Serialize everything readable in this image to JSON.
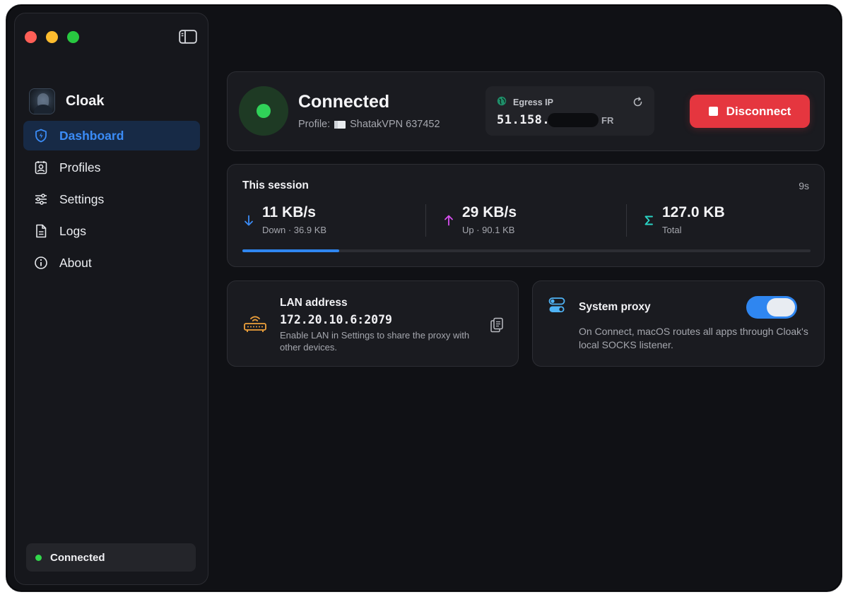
{
  "app": {
    "name": "Cloak"
  },
  "sidebar": {
    "items": [
      {
        "label": "Dashboard",
        "icon": "shield-bolt-icon",
        "active": true
      },
      {
        "label": "Profiles",
        "icon": "contact-card-icon",
        "active": false
      },
      {
        "label": "Settings",
        "icon": "sliders-icon",
        "active": false
      },
      {
        "label": "Logs",
        "icon": "document-icon",
        "active": false
      },
      {
        "label": "About",
        "icon": "info-icon",
        "active": false
      }
    ],
    "status_label": "Connected"
  },
  "status": {
    "title": "Connected",
    "profile_prefix": "Profile:",
    "profile_name": "ShatakVPN 637452",
    "egress": {
      "label": "Egress IP",
      "ip_visible": "51.158.",
      "country": "FR"
    },
    "disconnect_label": "Disconnect"
  },
  "session": {
    "title": "This session",
    "elapsed": "9s",
    "down": {
      "value": "11 KB/s",
      "sub": "Down · 36.9 KB"
    },
    "up": {
      "value": "29 KB/s",
      "sub": "Up · 90.1 KB"
    },
    "total": {
      "value": "127.0 KB",
      "sub": "Total"
    },
    "progress_fraction": 0.17
  },
  "lan": {
    "title": "LAN address",
    "address": "172.20.10.6:2079",
    "hint": "Enable LAN in Settings to share the proxy with other devices."
  },
  "proxy": {
    "title": "System proxy",
    "enabled": true,
    "hint": "On Connect, macOS routes all apps through Cloak's local SOCKS listener."
  },
  "colors": {
    "accent": "#2f86f0",
    "connected_green": "#30d158",
    "danger_red": "#e5363f",
    "upload_magenta": "#d84ff0",
    "total_teal": "#2ad3c4",
    "lan_orange": "#f0a23b"
  }
}
